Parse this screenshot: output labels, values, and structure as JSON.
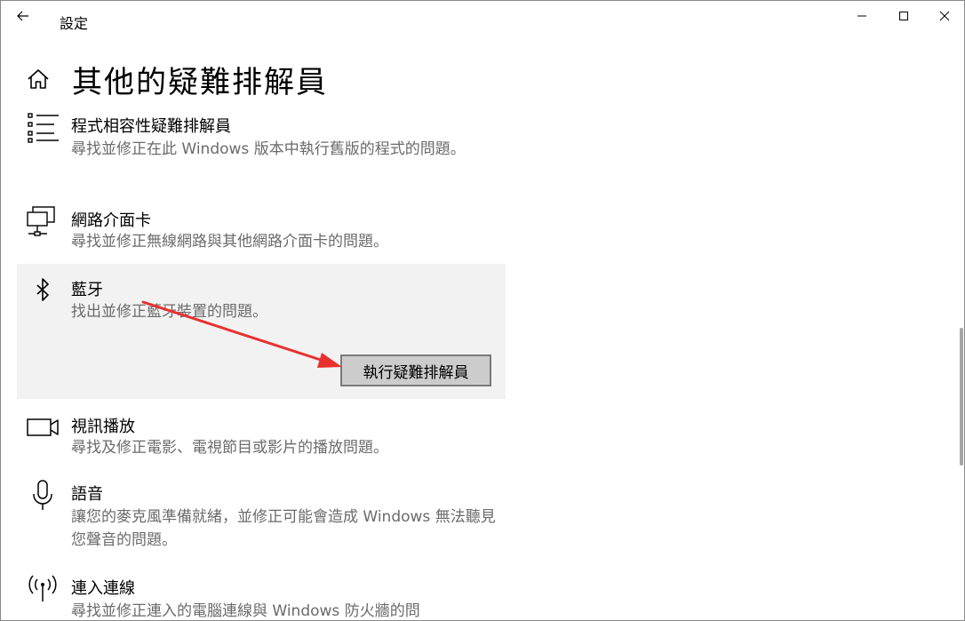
{
  "window": {
    "title": "設定"
  },
  "page": {
    "title": "其他的疑難排解員"
  },
  "items": [
    {
      "name": "程式相容性疑難排解員",
      "description": "尋找並修正在此 Windows 版本中執行舊版的程式的問題。",
      "icon": "list-icon"
    },
    {
      "name": "網路介面卡",
      "description": "尋找並修正無線網路與其他網路介面卡的問題。",
      "icon": "network-adapter-icon"
    },
    {
      "name": "藍牙",
      "description": "找出並修正藍牙裝置的問題。",
      "icon": "bluetooth-icon",
      "button_label": "執行疑難排解員"
    },
    {
      "name": "視訊播放",
      "description": "尋找及修正電影、電視節目或影片的播放問題。",
      "icon": "video-camera-icon"
    },
    {
      "name": "語音",
      "description": "讓您的麥克風準備就緒，並修正可能會造成 Windows 無法聽見您聲音的問題。",
      "icon": "microphone-icon"
    },
    {
      "name": "連入連線",
      "description": "尋找並修正連入的電腦連線與 Windows 防火牆的問",
      "icon": "antenna-icon"
    }
  ],
  "colors": {
    "accent_arrow": "#e8312f",
    "selected_bg": "#f2f2f2",
    "description_text": "#6b6b6b"
  }
}
